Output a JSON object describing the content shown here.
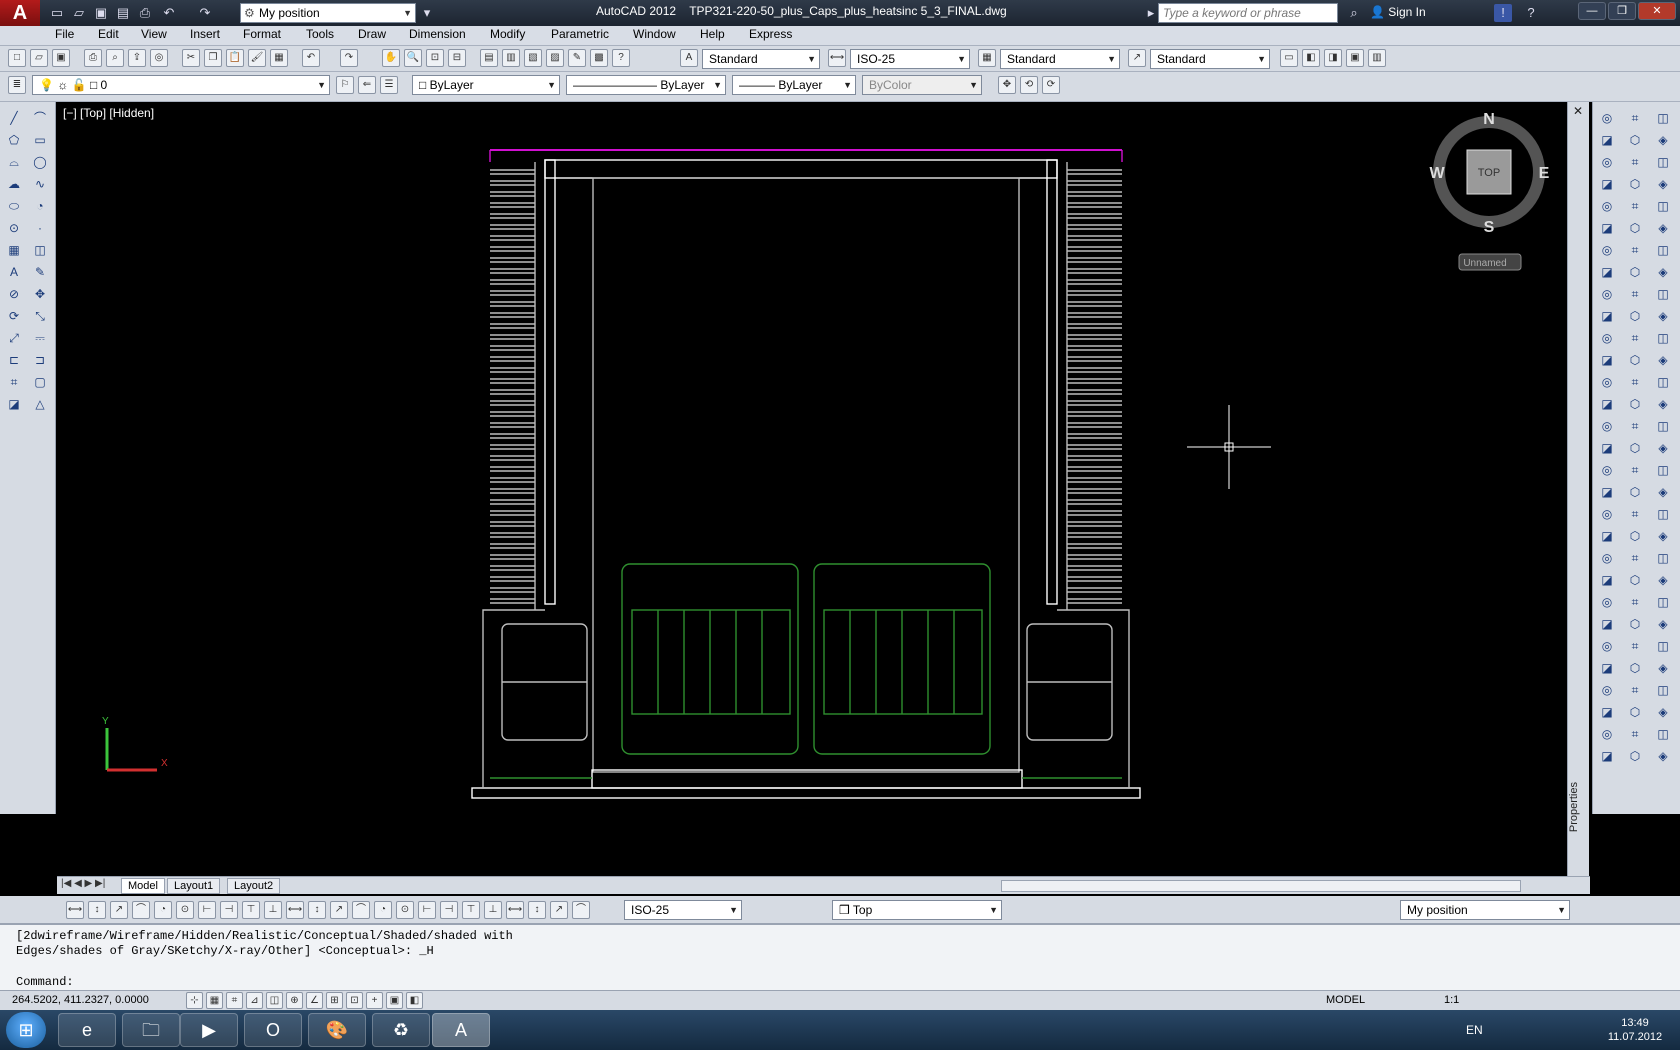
{
  "titlebar": {
    "app_letter": "A",
    "workspace": "My position",
    "app_name": "AutoCAD 2012",
    "file_name": "TPP321-220-50_plus_Caps_plus_heatsinc 5_3_FINAL.dwg",
    "search_placeholder": "Type a keyword or phrase",
    "sign_in": "Sign In"
  },
  "menu": [
    "File",
    "Edit",
    "View",
    "Insert",
    "Format",
    "Tools",
    "Draw",
    "Dimension",
    "Modify",
    "Parametric",
    "Window",
    "Help",
    "Express"
  ],
  "styles_toolbar": {
    "text_style": "Standard",
    "dim_style": "ISO-25",
    "table_style": "Standard",
    "mleader_style": "Standard"
  },
  "layers_toolbar": {
    "layer": "0",
    "color": "ByLayer",
    "linetype": "ByLayer",
    "lineweight": "ByLayer",
    "plotstyle": "ByColor"
  },
  "viewport": {
    "label": "[−] [Top] [Hidden]",
    "viewcube": {
      "n": "N",
      "s": "S",
      "e": "E",
      "w": "W",
      "face": "TOP",
      "ucs": "Unnamed"
    },
    "ucs_x": "X",
    "ucs_y": "Y",
    "properties_tab": "Properties",
    "colors": {
      "magenta": "#d010d0",
      "white": "#ffffff",
      "green": "#2f8f2f",
      "gray": "#bdbdbd"
    }
  },
  "layout_tabs": [
    "Model",
    "Layout1",
    "Layout2"
  ],
  "bottom_toolbar": {
    "dim_style": "ISO-25",
    "view": "Top",
    "workspace": "My position"
  },
  "command": {
    "history_1": "[2dwireframe/Wireframe/Hidden/Realistic/Conceptual/Shaded/shaded with",
    "history_2": "Edges/shades of Gray/SKetchy/X-ray/Other] <Conceptual>: _H",
    "prompt": "Command:"
  },
  "status": {
    "coords": "264.5202, 411.2327, 0.0000",
    "model": "MODEL",
    "annotation_scale": "1:1"
  },
  "taskbar": {
    "lang": "EN",
    "time": "13:49",
    "date": "11.07.2012"
  }
}
